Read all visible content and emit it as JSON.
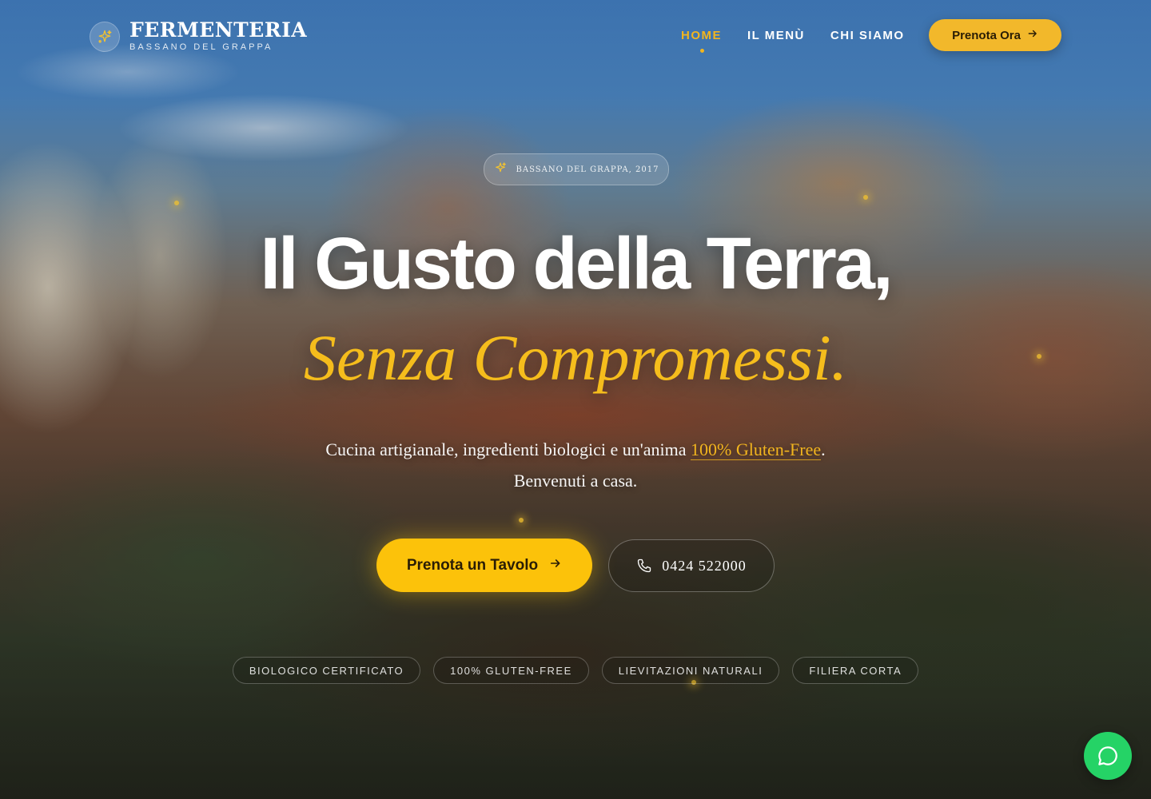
{
  "brand": {
    "name": "FERMENTERIA",
    "subtitle": "BASSANO DEL GRAPPA",
    "icon": "sparkles-icon"
  },
  "nav": {
    "items": [
      {
        "label": "HOME",
        "active": true
      },
      {
        "label": "IL MENÙ",
        "active": false
      },
      {
        "label": "CHI SIAMO",
        "active": false
      }
    ],
    "cta_label": "Prenota Ora"
  },
  "hero": {
    "badge": "BASSANO DEL GRAPPA, 2017",
    "title_line1": "Il Gusto della Terra,",
    "title_line2": "Senza Compromessi.",
    "subtitle_before": "Cucina artigianale, ingredienti biologici e un'anima ",
    "subtitle_highlight": "100% Gluten-Free",
    "subtitle_after": ".",
    "subtitle_line2": "Benvenuti a casa.",
    "primary_cta": "Prenota un Tavolo",
    "phone": "0424 522000",
    "features": [
      "BIOLOGICO CERTIFICATO",
      "100% GLUTEN-FREE",
      "LIEVITAZIONI NATURALI",
      "FILIERA CORTA"
    ]
  },
  "chat": {
    "icon": "chat-bubble-icon"
  },
  "colors": {
    "accent": "#f2b51e",
    "primary_button": "#fcc20a",
    "chat_button": "#25d366"
  }
}
